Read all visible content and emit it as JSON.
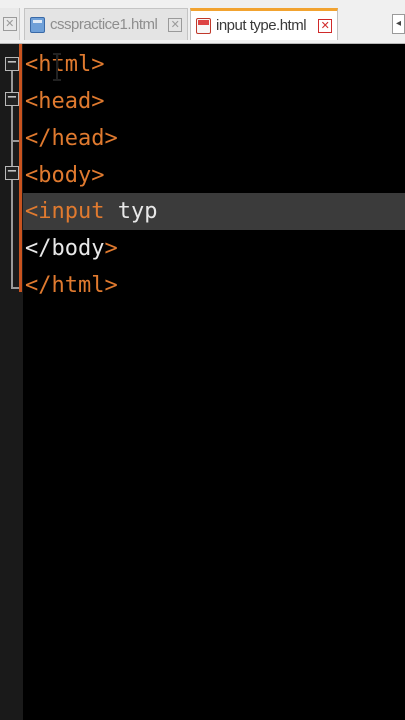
{
  "tabs": [
    {
      "label": "",
      "icon": "close-icon",
      "active": false
    },
    {
      "label": "csspractice1.html",
      "icon": "css-file-icon",
      "close": "✕",
      "active": false
    },
    {
      "label": "input type.html",
      "icon": "html-file-icon",
      "close": "✕",
      "active": true
    }
  ],
  "scroll_arrow": "◂",
  "close_glyph": "✕",
  "fold_glyph": "−",
  "code": {
    "lines": [
      "<html>",
      "<head>",
      "</head>",
      "<body>",
      "<input typ",
      "</body>",
      "</html>"
    ],
    "current_line": 5
  },
  "colors": {
    "tag": "#e07a2f",
    "text": "#e8e8e8",
    "background": "#000000",
    "highlight": "#3b3b3b",
    "active_tab_accent": "#f2a330"
  }
}
